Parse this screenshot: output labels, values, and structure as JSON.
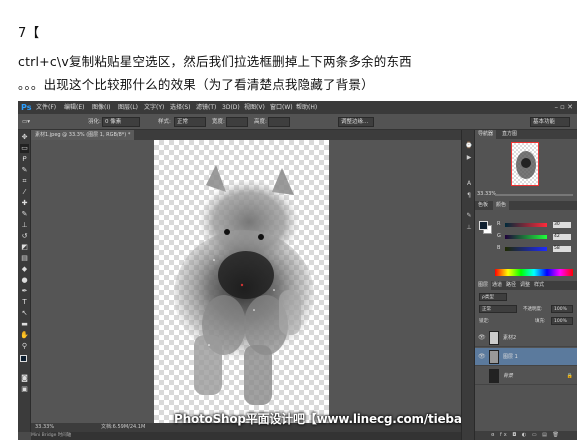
{
  "post": {
    "line1": "7【",
    "line2": "ctrl+c\\v复制粘贴星空选区，然后我们拉选框删掉上下两条多余的东西",
    "line3": "。。。出现这个比较那什么的效果（为了看清楚点我隐藏了背景）"
  },
  "menu": {
    "logo": "Ps",
    "items": [
      "文件(F)",
      "编辑(E)",
      "图像(I)",
      "图层(L)",
      "文字(Y)",
      "选择(S)",
      "滤镜(T)",
      "3D(D)",
      "视图(V)",
      "窗口(W)",
      "帮助(H)"
    ],
    "window_controls": "–  ▫  ✕"
  },
  "options": {
    "feather_label": "羽化:",
    "feather_value": "0 像素",
    "style_label": "样式:",
    "style_value": "正常",
    "width_label": "宽度:",
    "height_label": "高度:",
    "refine_btn": "调整边缘...",
    "workspace": "基本功能"
  },
  "document": {
    "tab": "素材1.jpeg @ 33.3% (图层 1, RGB/8*) *",
    "zoom": "33.33%",
    "docinfo": "文档:6.59M/24.1M"
  },
  "bottom_tabs": "Mini Bridge   时间轴",
  "watermark": "PhotoShop平面设计吧【www.linecg.com/tieba/1783】",
  "panels": {
    "nav_tabs": [
      "导航器",
      "直方图"
    ],
    "nav_zoom": "33.33%",
    "color_tabs": [
      "色板",
      "颜色"
    ],
    "color": {
      "r_label": "R",
      "g_label": "G",
      "b_label": "B",
      "r": "30",
      "g": "42",
      "b": "58"
    },
    "layer_tabs": [
      "图层",
      "通道",
      "路径",
      "调整",
      "样式"
    ],
    "kind_label": "ρ类型",
    "blend_mode": "正常",
    "opacity_label": "不透明度:",
    "opacity": "100%",
    "lock_label": "锁定:",
    "fill_label": "填充:",
    "fill": "100%",
    "layers": [
      {
        "name": "素材2",
        "visible": true
      },
      {
        "name": "图层 1",
        "visible": true,
        "selected": true
      },
      {
        "name": "背景",
        "visible": false,
        "locked": true
      }
    ],
    "layer_footer": "ɞ fx ◘ ◐ ▭ ▤ 🗑"
  }
}
